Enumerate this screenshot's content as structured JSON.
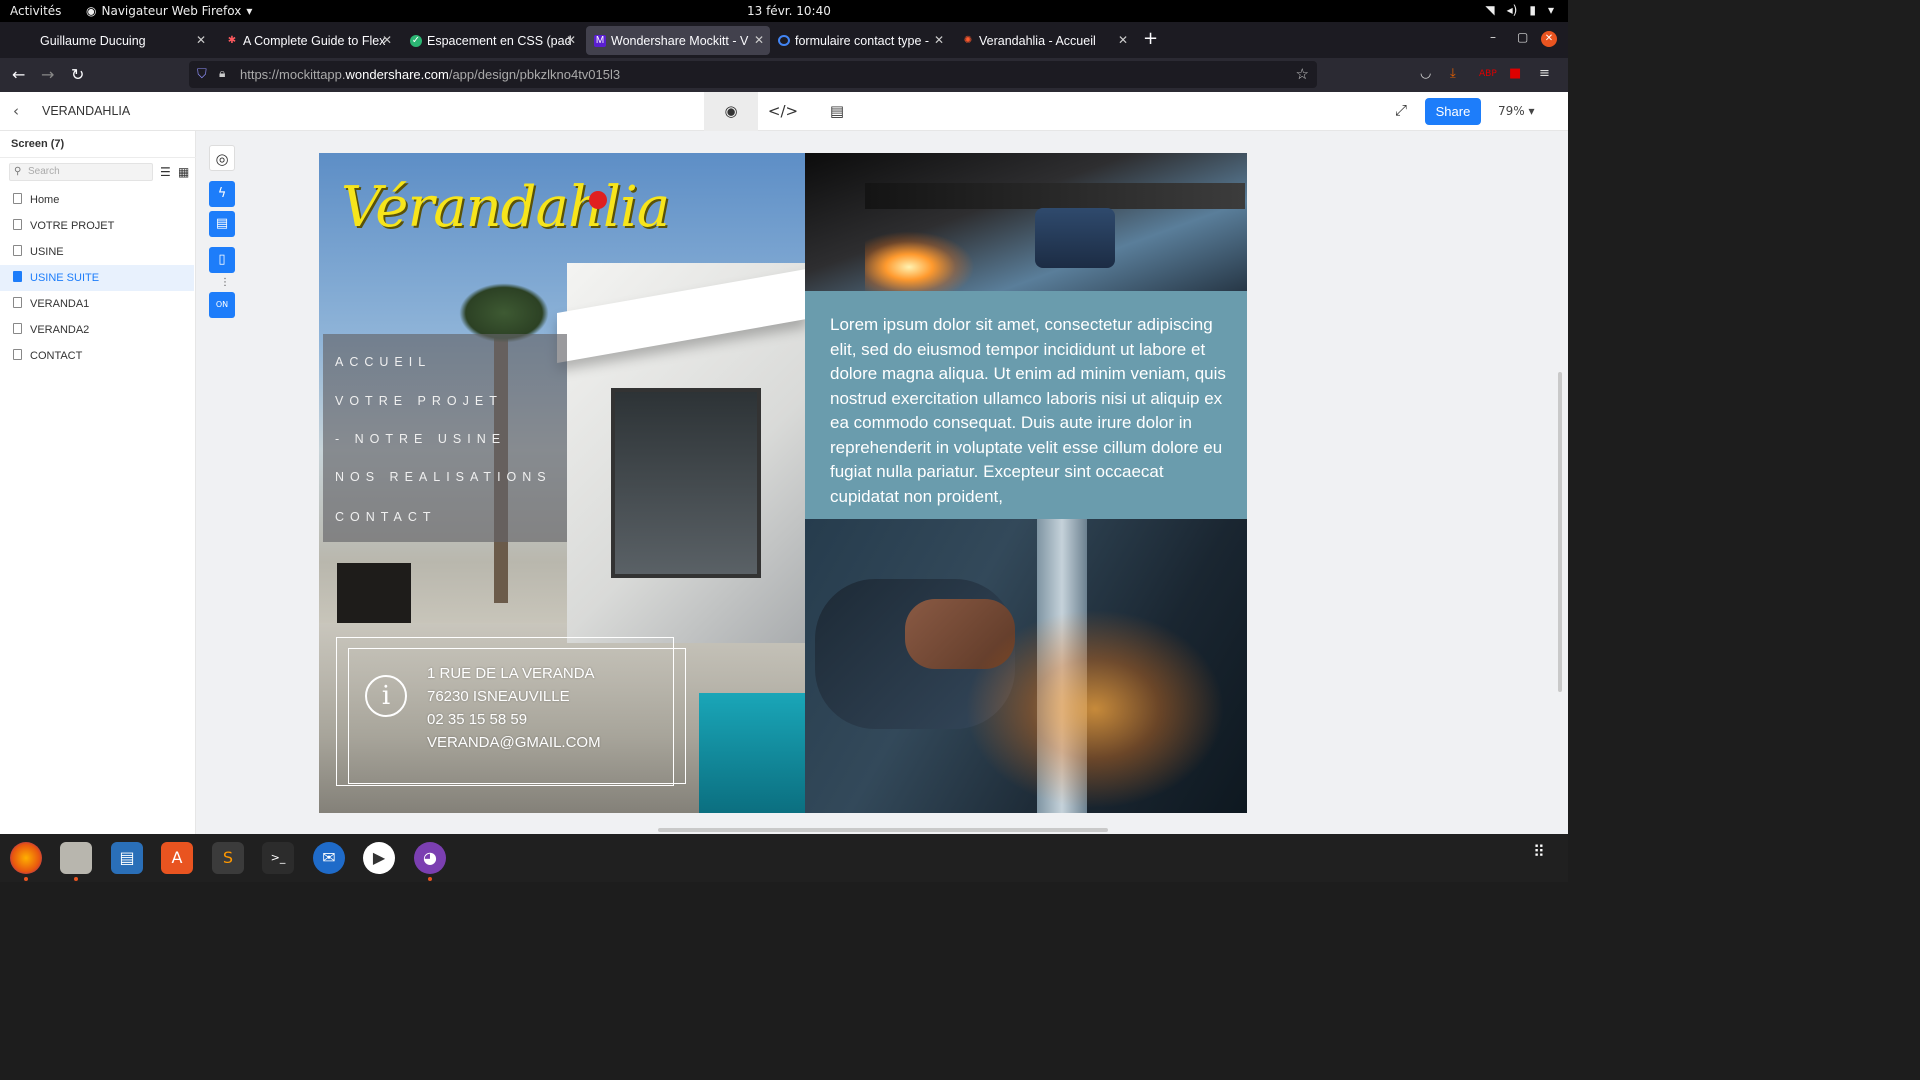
{
  "system": {
    "activities": "Activités",
    "app_name": "Navigateur Web Firefox",
    "clock": "13 févr.  10:40"
  },
  "tabs": [
    {
      "label": "Guillaume Ducuing",
      "active": false
    },
    {
      "label": "A Complete Guide to Flex",
      "active": false
    },
    {
      "label": "Espacement en CSS (pad",
      "active": false
    },
    {
      "label": "Wondershare Mockitt - V",
      "active": true
    },
    {
      "label": "formulaire contact type -",
      "active": false
    },
    {
      "label": "Verandahlia - Accueil",
      "active": false
    }
  ],
  "url": {
    "prefix": "https://mockittapp.",
    "domain": "wondershare.com",
    "path": "/app/design/pbkzlkno4tv015l3"
  },
  "mockitt": {
    "project_name": "VERANDAHLIA",
    "share_label": "Share",
    "zoom": "79%",
    "screen_heading": "Screen  (7)",
    "search_placeholder": "Search",
    "pages": [
      {
        "label": "Home",
        "active": false
      },
      {
        "label": "VOTRE PROJET",
        "active": false
      },
      {
        "label": "USINE",
        "active": false
      },
      {
        "label": "USINE SUITE",
        "active": true
      },
      {
        "label": "VERANDA1",
        "active": false
      },
      {
        "label": "VERANDA2",
        "active": false
      },
      {
        "label": "CONTACT",
        "active": false
      }
    ],
    "accent_color": "#1d7dfa"
  },
  "design": {
    "logo": "Vérandahlia",
    "menu": [
      "ACCUEIL",
      "VOTRE PROJET",
      "- NOTRE USINE",
      "NOS REALISATIONS",
      "CONTACT"
    ],
    "contact": {
      "address": " 1 RUE DE LA VERANDA",
      "city": "76230 ISNEAUVILLE",
      "phone": "02 35 15 58 59",
      "email": "VERANDA@GMAIL.COM"
    },
    "lorem": "Lorem ipsum dolor sit amet, consectetur adipiscing elit, sed do eiusmod tempor incididunt ut labore et dolore magna aliqua. Ut enim ad minim veniam, quis nostrud exercitation ullamco laboris nisi ut aliquip ex ea commodo consequat. Duis aute irure dolor in reprehenderit in voluptate velit esse cillum dolore eu fugiat nulla pariatur. Excepteur sint occaecat cupidatat non proident,",
    "panel_color": "#6a9cad",
    "logo_color": "#f7e51b"
  }
}
